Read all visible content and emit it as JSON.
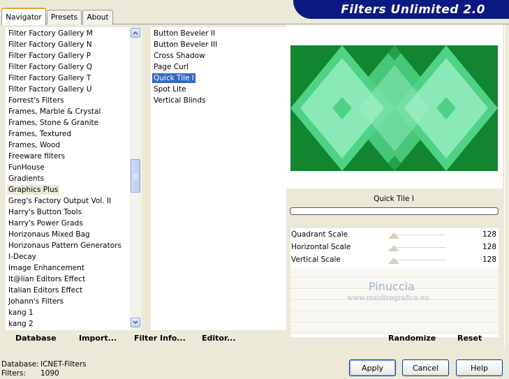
{
  "tabs": [
    {
      "label": "Navigator"
    },
    {
      "label": "Presets"
    },
    {
      "label": "About"
    }
  ],
  "banner": {
    "title": "Filters Unlimited 2.0"
  },
  "categories": {
    "items": [
      "Filter Factory Gallery M",
      "Filter Factory Gallery N",
      "Filter Factory Gallery P",
      "Filter Factory Gallery Q",
      "Filter Factory Gallery T",
      "Filter Factory Gallery U",
      "Forrest's Filters",
      "Frames, Marble & Crystal",
      "Frames, Stone & Granite",
      "Frames, Textured",
      "Frames, Wood",
      "Freeware filters",
      "FunHouse",
      "Gradients",
      "Graphics Plus",
      "Greg's Factory Output Vol. II",
      "Harry's Button Tools",
      "Harry's Power Grads",
      "Horizonaus Mixed Bag",
      "Horizonaus Pattern Generators",
      "I-Decay",
      "Image Enhancement",
      "It@lian Editors Effect",
      "Italian Editors Effect",
      "Johann's Filters",
      "kang 1",
      "kang 2"
    ],
    "selected": "Graphics Plus"
  },
  "filters": {
    "items": [
      "Button Beveler II",
      "Button Beveler III",
      "Cross Shadow",
      "Page Curl",
      "Quick Tile I",
      "Spot Lite",
      "Vertical Blinds"
    ],
    "selected": "Quick Tile I"
  },
  "preview": {
    "filter_name": "Quick Tile I",
    "colors": {
      "dark": "#11852f",
      "mid": "#50d286",
      "light": "#9ff0c8"
    }
  },
  "params": [
    {
      "label": "Quadrant Scale",
      "value": "128"
    },
    {
      "label": "Horizontal Scale",
      "value": "128"
    },
    {
      "label": "Vertical Scale",
      "value": "128"
    }
  ],
  "watermark": {
    "name": "Pinuccia",
    "site": "www.maidiregrafica.eu"
  },
  "commands": {
    "database": "Database",
    "import": "Import...",
    "filter_info": "Filter Info...",
    "editor": "Editor...",
    "randomize": "Randomize",
    "reset": "Reset"
  },
  "status": {
    "database_label": "Database:",
    "database_value": "ICNET-Filters",
    "filters_label": "Filters:",
    "filters_value": "1090"
  },
  "buttons": {
    "apply": "Apply",
    "cancel": "Cancel",
    "help": "Help"
  }
}
